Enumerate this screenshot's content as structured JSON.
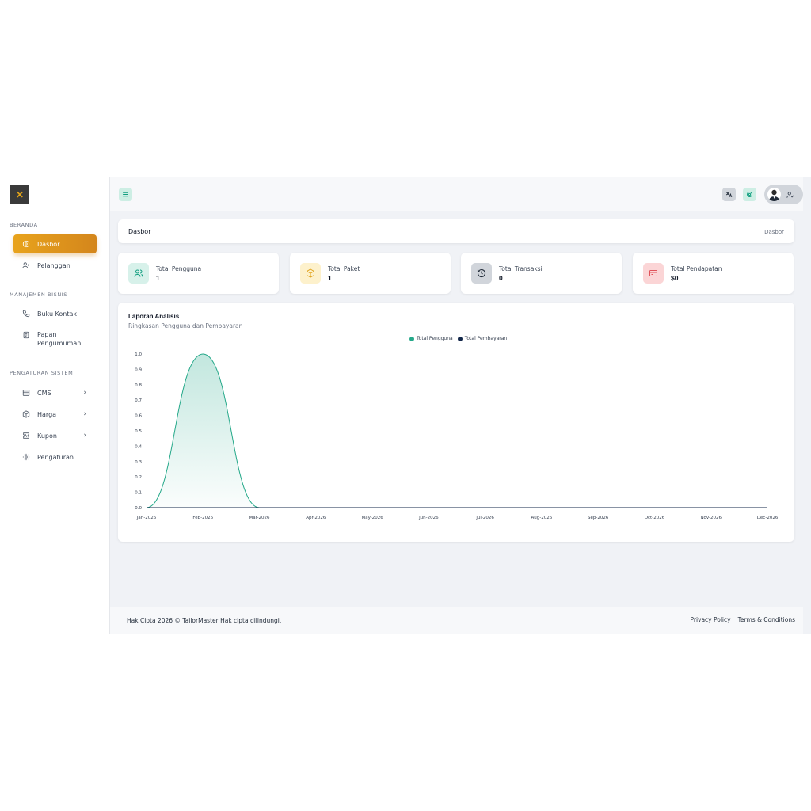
{
  "sidebar": {
    "sections": [
      {
        "title": "BERANDA"
      },
      {
        "title": "MANAJEMEN BISNIS"
      },
      {
        "title": "PENGATURAN SISTEM"
      }
    ],
    "items": [
      {
        "label": "Dasbor",
        "icon": "dashboard-icon"
      },
      {
        "label": "Pelanggan",
        "icon": "user-plus-icon"
      },
      {
        "label": "Buku Kontak",
        "icon": "phone-icon"
      },
      {
        "label": "Papan Pengumuman",
        "icon": "clipboard-icon"
      },
      {
        "label": "CMS",
        "icon": "layout-icon"
      },
      {
        "label": "Harga",
        "icon": "package-icon"
      },
      {
        "label": "Kupon",
        "icon": "ticket-icon"
      },
      {
        "label": "Pengaturan",
        "icon": "gear-icon"
      }
    ],
    "chevron": "›"
  },
  "breadcrumb": {
    "title": "Dasbor",
    "current": "Dasbor"
  },
  "stats": [
    {
      "label": "Total Pengguna",
      "value": "1",
      "color": "#0f9e7f",
      "bg": "#d7f1ea"
    },
    {
      "label": "Total Paket",
      "value": "1",
      "color": "#e0a21a",
      "bg": "#fdf1cc"
    },
    {
      "label": "Total Transaksi",
      "value": "0",
      "color": "#1f2937",
      "bg": "#d1d5db"
    },
    {
      "label": "Total Pendapatan",
      "value": "$0",
      "color": "#e0525a",
      "bg": "#fbd5d6"
    }
  ],
  "chart": {
    "title": "Laporan Analisis",
    "subtitle": "Ringkasan Pengguna dan Pembayaran"
  },
  "chart_data": {
    "type": "area",
    "x": [
      "Jan-2026",
      "Feb-2026",
      "Mar-2026",
      "Apr-2026",
      "May-2026",
      "Jun-2026",
      "Jul-2026",
      "Aug-2026",
      "Sep-2026",
      "Oct-2026",
      "Nov-2026",
      "Dec-2026"
    ],
    "series": [
      {
        "name": "Total Pengguna",
        "values": [
          0,
          1,
          0,
          0,
          0,
          0,
          0,
          0,
          0,
          0,
          0,
          0
        ],
        "color": "#26a98a"
      },
      {
        "name": "Total Pembayaran",
        "values": [
          0,
          0,
          0,
          0,
          0,
          0,
          0,
          0,
          0,
          0,
          0,
          0
        ],
        "color": "#13274a"
      }
    ],
    "yticks": [
      "1.0",
      "0.9",
      "0.8",
      "0.7",
      "0.6",
      "0.5",
      "0.4",
      "0.3",
      "0.2",
      "0.1",
      "0.0"
    ],
    "ylim": [
      0,
      1
    ],
    "grid": false,
    "legend": "top-center"
  },
  "footer": {
    "copyright": "Hak Cipta 2026 © TailorMaster Hak cipta dilindungi.",
    "privacy": "Privacy Policy",
    "terms": "Terms & Conditions"
  }
}
